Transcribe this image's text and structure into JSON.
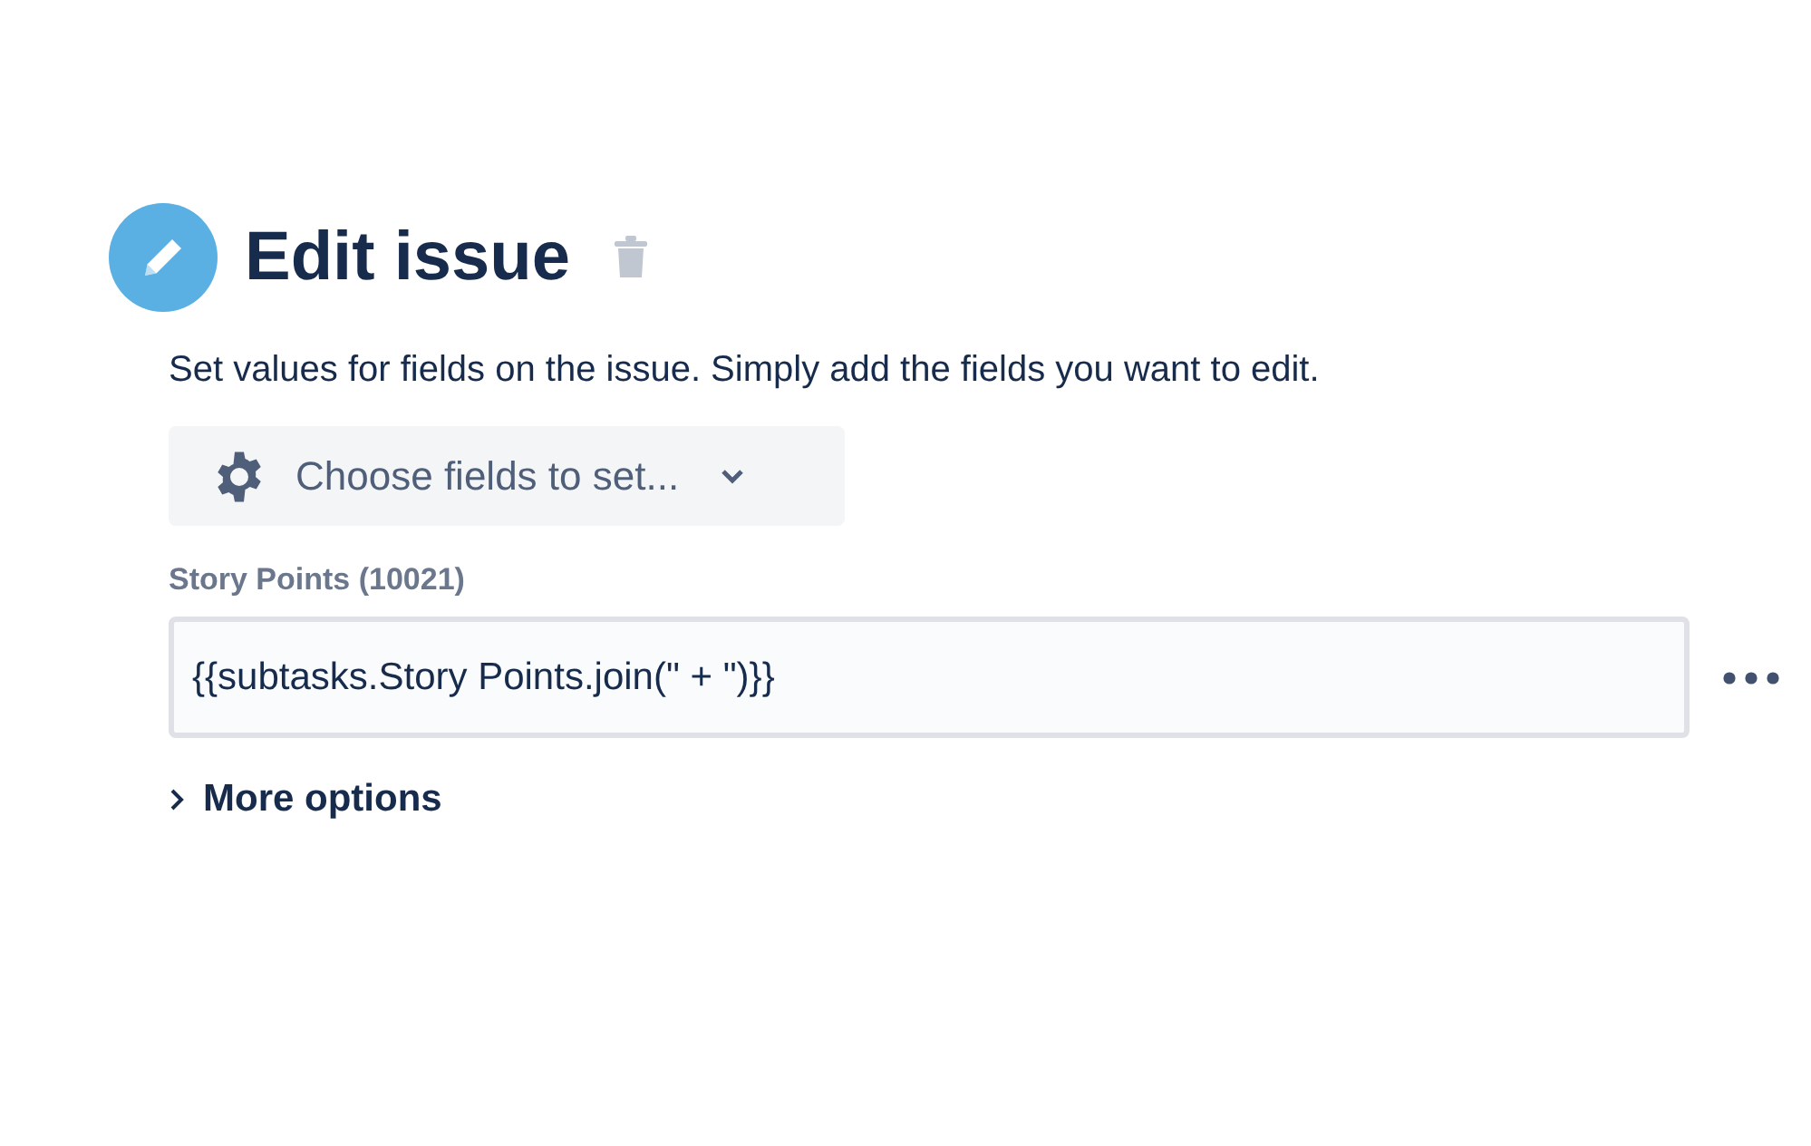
{
  "header": {
    "title": "Edit issue"
  },
  "description": "Set values for fields on the issue. Simply add the fields you want to edit.",
  "field_picker": {
    "label": "Choose fields to set..."
  },
  "fields": [
    {
      "label": "Story Points (10021)",
      "value": "{{subtasks.Story Points.join(\" + \")}}"
    }
  ],
  "more_options": {
    "label": "More options",
    "expanded": false
  }
}
